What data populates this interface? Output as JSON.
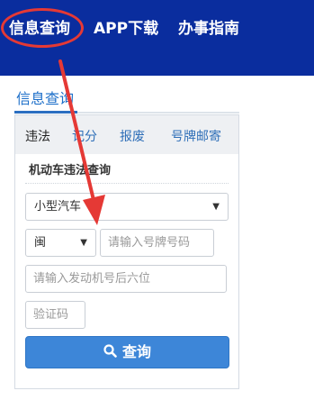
{
  "nav": {
    "items": [
      "信息查询",
      "APP下载",
      "办事指南"
    ]
  },
  "section": {
    "title": "信息查询"
  },
  "tabs": [
    "违法",
    "记分",
    "报废",
    "号牌邮寄"
  ],
  "form": {
    "title": "机动车违法查询",
    "vehicle_type": "小型汽车",
    "province": "闽",
    "plate_placeholder": "请输入号牌号码",
    "engine_placeholder": "请输入发动机号后六位",
    "captcha_placeholder": "验证码",
    "query_label": "查询"
  },
  "colors": {
    "nav_bg": "#0a2d9e",
    "accent": "#2b6fc1",
    "button": "#3d86d8",
    "annotation": "#e53935"
  },
  "icons": {
    "caret": "caret-down-icon",
    "search": "search-icon"
  }
}
